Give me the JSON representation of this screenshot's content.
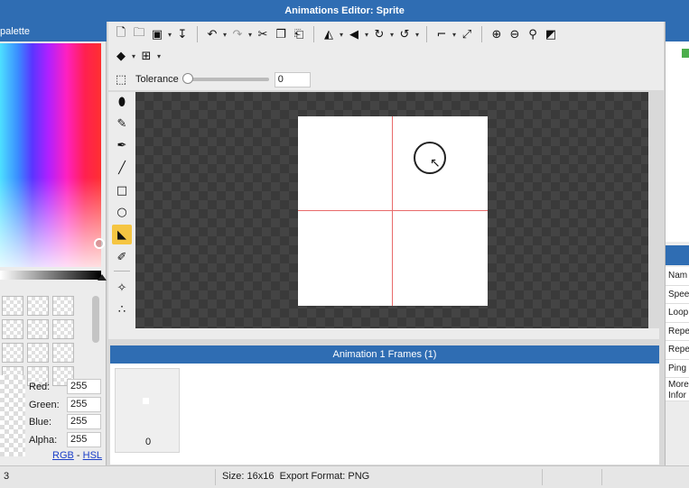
{
  "window": {
    "title": "Animations Editor: Sprite"
  },
  "palette": {
    "header": "palette",
    "red_label": "Red:",
    "red": "255",
    "green_label": "Green:",
    "green": "255",
    "blue_label": "Blue:",
    "blue": "255",
    "alpha_label": "Alpha:",
    "alpha": "255",
    "rgb_link": "RGB",
    "link_separator": "-",
    "hsl_link": "HSL"
  },
  "toolbar": {
    "row1_icons": [
      "new-file-icon",
      "open-folder-icon",
      "save-icon",
      "export-icon",
      "undo-icon",
      "redo-icon",
      "cut-icon",
      "copy-icon",
      "paste-icon",
      "flip-horizontal-icon",
      "flip-vertical-icon",
      "rotate-cw-icon",
      "rotate-ccw-icon",
      "crop-icon",
      "resize-icon",
      "zoom-in-icon",
      "zoom-out-icon",
      "zoom-fit-icon",
      "background-toggle-icon"
    ],
    "row2_icons": [
      "layers-icon",
      "grid-icon"
    ],
    "tolerance_label": "Tolerance",
    "tolerance_value": "0",
    "tolerance_fraction": 0
  },
  "tools": [
    "select-icon",
    "eraser-icon",
    "pencil-icon",
    "brush-icon",
    "line-icon",
    "rectangle-icon",
    "ellipse-icon",
    "fill-bucket-icon",
    "eyedropper-icon",
    "point-icon",
    "node-icon"
  ],
  "active_tool": "fill-bucket-icon",
  "frames": {
    "header": "Animation 1 Frames (1)",
    "items": [
      {
        "number": "0"
      }
    ]
  },
  "properties": {
    "items": [
      "Nam",
      "Spee",
      "Loop",
      "Repe",
      "Repe",
      "Ping",
      "More\nInfor"
    ]
  },
  "status": {
    "left": "3",
    "size": "Size: 16x16",
    "export_format": "Export Format: PNG"
  },
  "colors": {
    "accent": "#2f6db3",
    "grid_line": "#e86a6a",
    "active_tool": "#f5c542"
  }
}
